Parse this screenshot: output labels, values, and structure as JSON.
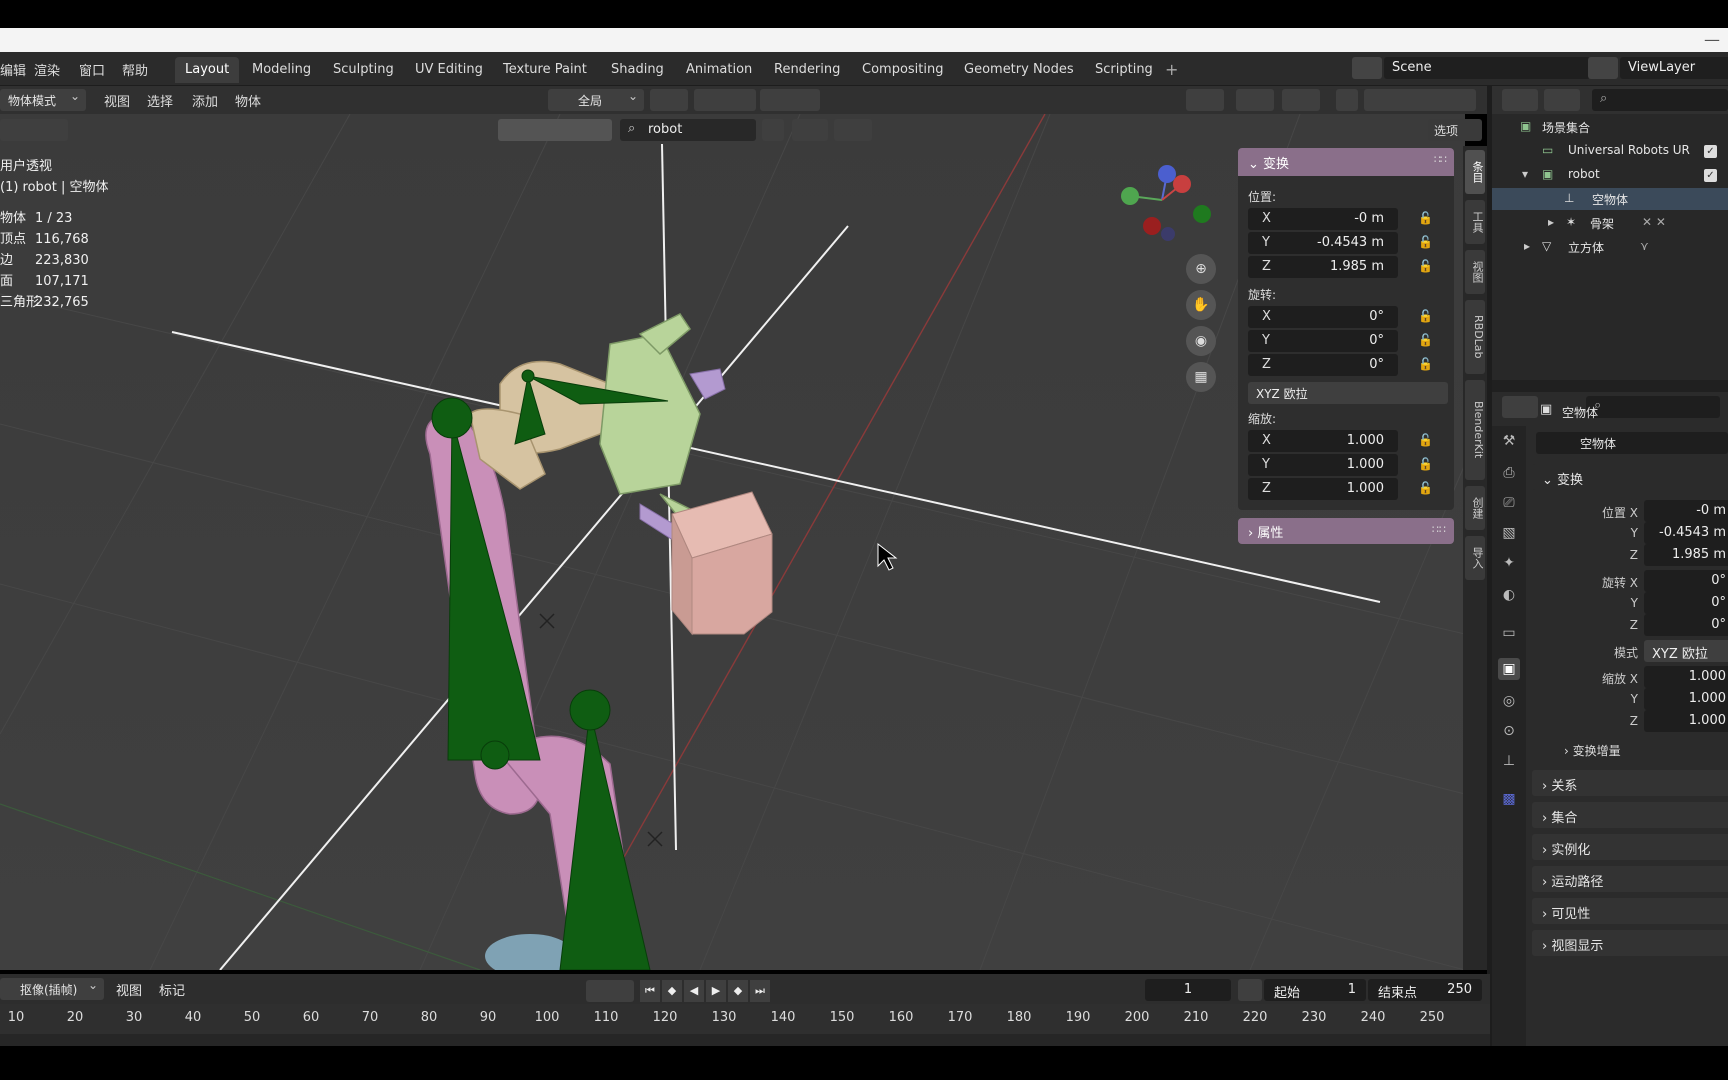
{
  "menus": [
    "编辑",
    "渲染",
    "窗口",
    "帮助"
  ],
  "workspaces": [
    "Layout",
    "Modeling",
    "Sculpting",
    "UV Editing",
    "Texture Paint",
    "Shading",
    "Animation",
    "Rendering",
    "Compositing",
    "Geometry Nodes",
    "Scripting"
  ],
  "active_workspace": "Layout",
  "scene": "Scene",
  "view_layer": "ViewLayer",
  "header": {
    "mode": "物体模式",
    "view": "视图",
    "select": "选择",
    "add": "添加",
    "object": "物体",
    "orientation": "全局",
    "options": "选项"
  },
  "viewport_search": "robot",
  "overlay_info": {
    "title": "用户透视",
    "context": "(1) robot | 空物体",
    "stats": [
      {
        "label": "物体",
        "value": "1 / 23"
      },
      {
        "label": "顶点",
        "value": "116,768"
      },
      {
        "label": "边",
        "value": "223,830"
      },
      {
        "label": "面",
        "value": "107,171"
      },
      {
        "label": "三角形",
        "value": "232,765"
      }
    ]
  },
  "npanel": {
    "transform_title": "变换",
    "location_label": "位置:",
    "location": [
      {
        "axis": "X",
        "value": "-0 m"
      },
      {
        "axis": "Y",
        "value": "-0.4543 m"
      },
      {
        "axis": "Z",
        "value": "1.985 m"
      }
    ],
    "rotation_label": "旋转:",
    "rotation": [
      {
        "axis": "X",
        "value": "0°"
      },
      {
        "axis": "Y",
        "value": "0°"
      },
      {
        "axis": "Z",
        "value": "0°"
      }
    ],
    "rotation_mode": "XYZ 欧拉",
    "scale_label": "缩放:",
    "scale": [
      {
        "axis": "X",
        "value": "1.000"
      },
      {
        "axis": "Y",
        "value": "1.000"
      },
      {
        "axis": "Z",
        "value": "1.000"
      }
    ],
    "properties_title": "属性"
  },
  "side_tabs": [
    "条目",
    "工具",
    "视图",
    "RBDLab",
    "BlenderKit",
    "创建",
    "导入"
  ],
  "outliner": {
    "rows": [
      {
        "label": "场景集合"
      },
      {
        "label": "Universal Robots UR"
      },
      {
        "label": "robot"
      },
      {
        "label": "空物体"
      },
      {
        "label": "骨架"
      },
      {
        "label": "立方体"
      }
    ]
  },
  "properties": {
    "object_name": "空物体",
    "object_field": "空物体",
    "transform_section": "变换",
    "loc_label": "位置 X",
    "loc": [
      "-0 m",
      "-0.4543 m",
      "1.985 m"
    ],
    "rot_label": "旋转 X",
    "rot": [
      "0°",
      "0°",
      "0°"
    ],
    "mode_label": "模式",
    "mode": "XYZ 欧拉",
    "scale_label": "缩放 X",
    "scale": [
      "1.000",
      "1.000",
      "1.000"
    ],
    "y": "Y",
    "z": "Z",
    "delta": "变换增量",
    "sections": [
      "关系",
      "集合",
      "实例化",
      "运动路径",
      "可见性",
      "视图显示"
    ]
  },
  "timeline": {
    "playback": "抠像(插帧)",
    "view": "视图",
    "marker": "标记",
    "current_frame": "1",
    "start_label": "起始",
    "start": "1",
    "end_label": "结束点",
    "end": "250",
    "ticks": [
      "10",
      "20",
      "30",
      "40",
      "50",
      "60",
      "70",
      "80",
      "90",
      "100",
      "110",
      "120",
      "130",
      "140",
      "150",
      "160",
      "170",
      "180",
      "190",
      "200",
      "210",
      "220",
      "230",
      "240",
      "250"
    ]
  },
  "colors": {
    "panel_header": "#8a6f8a",
    "bone_green": "#0f5d12",
    "arm_pink": "#c98fb8",
    "gripper_green": "#b8d49a",
    "cube": "#d8a7a0"
  }
}
